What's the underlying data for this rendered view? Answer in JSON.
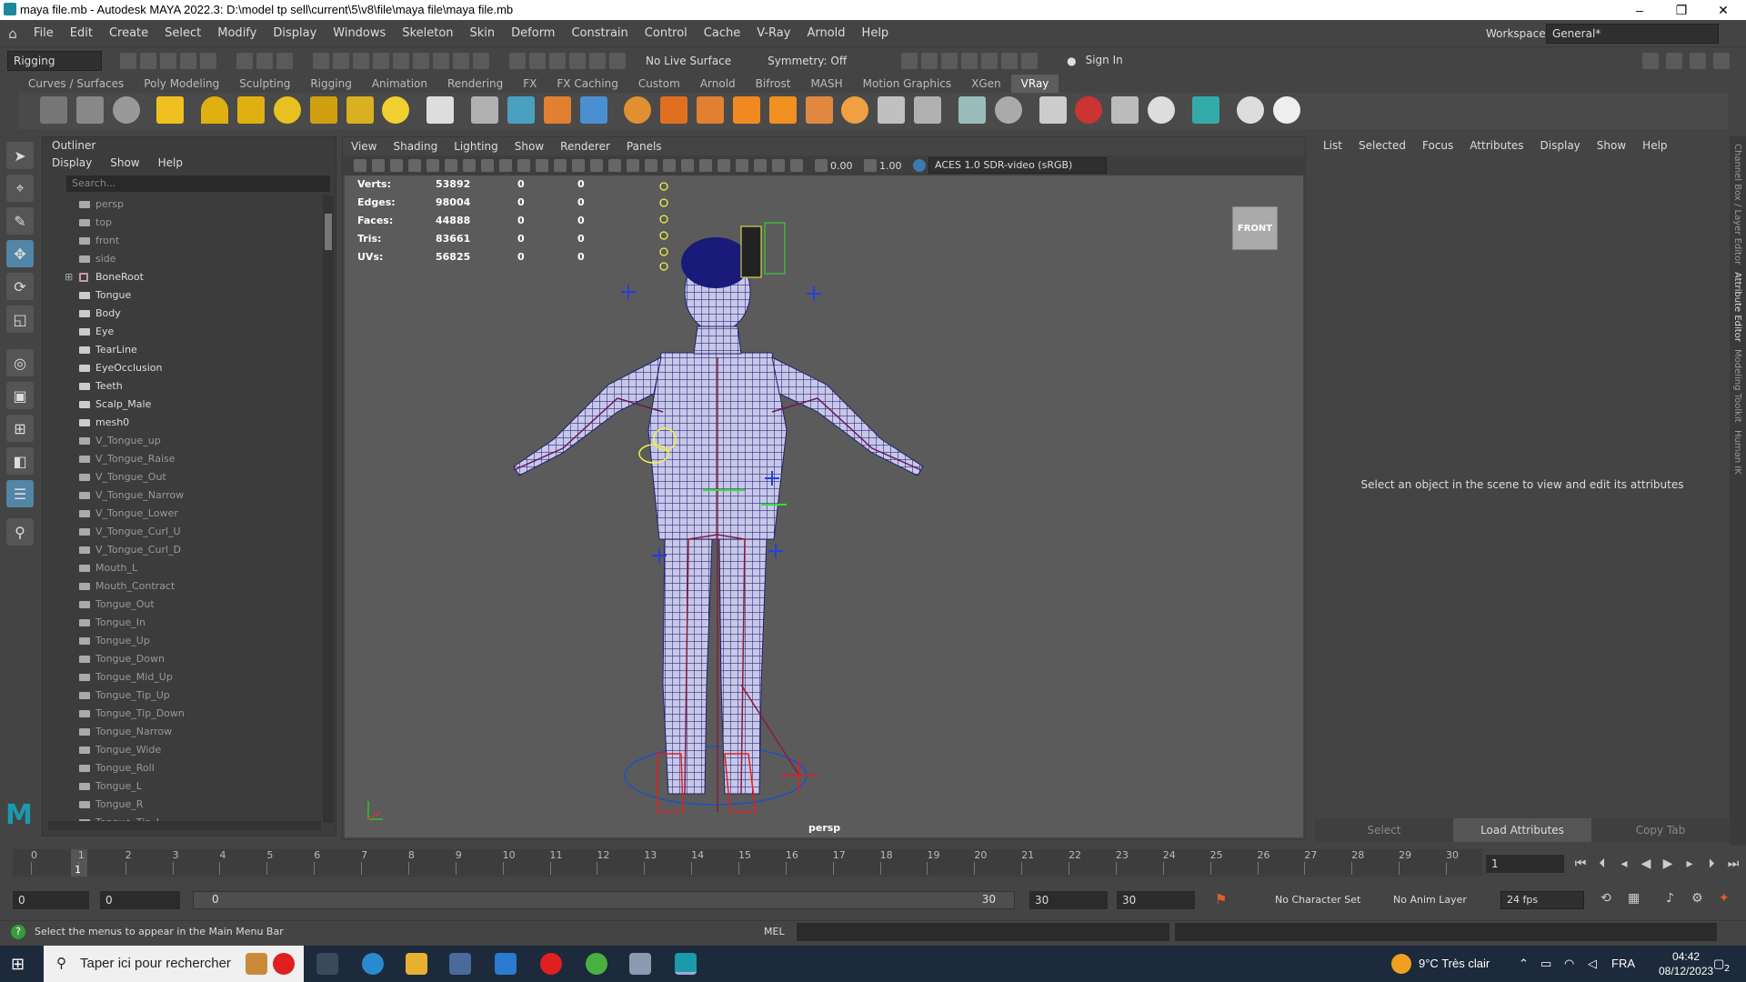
{
  "window": {
    "title": "maya file.mb - Autodesk MAYA 2022.3: D:\\model tp sell\\current\\5\\v8\\file\\maya file\\maya file.mb",
    "minimize": "–",
    "maximize": "❐",
    "close": "✕"
  },
  "menubar": {
    "items": [
      "File",
      "Edit",
      "Create",
      "Select",
      "Modify",
      "Display",
      "Windows",
      "Skeleton",
      "Skin",
      "Deform",
      "Constrain",
      "Control",
      "Cache",
      "V-Ray",
      "Arnold",
      "Help"
    ],
    "workspace_label": "Workspace:",
    "workspace_value": "General*"
  },
  "statusline": {
    "menuset": "Rigging",
    "live_surface": "No Live Surface",
    "symmetry": "Symmetry: Off",
    "sign_in": "Sign In"
  },
  "shelf": {
    "tabs": [
      "Curves / Surfaces",
      "Poly Modeling",
      "Sculpting",
      "Rigging",
      "Animation",
      "Rendering",
      "FX",
      "FX Caching",
      "Custom",
      "Arnold",
      "Bifrost",
      "MASH",
      "Motion Graphics",
      "XGen",
      "VRay"
    ],
    "active_tab": "VRay"
  },
  "outliner": {
    "title": "Outliner",
    "menu": [
      "Display",
      "Show",
      "Help"
    ],
    "search_placeholder": "Search...",
    "items": [
      {
        "label": "persp",
        "kind": "camera",
        "dim": true
      },
      {
        "label": "top",
        "kind": "camera",
        "dim": true
      },
      {
        "label": "front",
        "kind": "camera",
        "dim": true
      },
      {
        "label": "side",
        "kind": "camera",
        "dim": true
      },
      {
        "label": "BoneRoot",
        "kind": "joint",
        "dim": false,
        "expand": "⊞"
      },
      {
        "label": "Tongue",
        "kind": "mesh",
        "dim": false
      },
      {
        "label": "Body",
        "kind": "mesh",
        "dim": false
      },
      {
        "label": "Eye",
        "kind": "mesh",
        "dim": false
      },
      {
        "label": "TearLine",
        "kind": "mesh",
        "dim": false
      },
      {
        "label": "EyeOcclusion",
        "kind": "mesh",
        "dim": false
      },
      {
        "label": "Teeth",
        "kind": "mesh",
        "dim": false
      },
      {
        "label": "Scalp_Male",
        "kind": "mesh",
        "dim": false
      },
      {
        "label": "mesh0",
        "kind": "mesh",
        "dim": false
      },
      {
        "label": "V_Tongue_up",
        "kind": "mesh",
        "dim": true
      },
      {
        "label": "V_Tongue_Raise",
        "kind": "mesh",
        "dim": true
      },
      {
        "label": "V_Tongue_Out",
        "kind": "mesh",
        "dim": true
      },
      {
        "label": "V_Tongue_Narrow",
        "kind": "mesh",
        "dim": true
      },
      {
        "label": "V_Tongue_Lower",
        "kind": "mesh",
        "dim": true
      },
      {
        "label": "V_Tongue_Curl_U",
        "kind": "mesh",
        "dim": true
      },
      {
        "label": "V_Tongue_Curl_D",
        "kind": "mesh",
        "dim": true
      },
      {
        "label": "Mouth_L",
        "kind": "mesh",
        "dim": true
      },
      {
        "label": "Mouth_Contract",
        "kind": "mesh",
        "dim": true
      },
      {
        "label": "Tongue_Out",
        "kind": "mesh",
        "dim": true
      },
      {
        "label": "Tongue_In",
        "kind": "mesh",
        "dim": true
      },
      {
        "label": "Tongue_Up",
        "kind": "mesh",
        "dim": true
      },
      {
        "label": "Tongue_Down",
        "kind": "mesh",
        "dim": true
      },
      {
        "label": "Tongue_Mid_Up",
        "kind": "mesh",
        "dim": true
      },
      {
        "label": "Tongue_Tip_Up",
        "kind": "mesh",
        "dim": true
      },
      {
        "label": "Tongue_Tip_Down",
        "kind": "mesh",
        "dim": true
      },
      {
        "label": "Tongue_Narrow",
        "kind": "mesh",
        "dim": true
      },
      {
        "label": "Tongue_Wide",
        "kind": "mesh",
        "dim": true
      },
      {
        "label": "Tongue_Roll",
        "kind": "mesh",
        "dim": true
      },
      {
        "label": "Tongue_L",
        "kind": "mesh",
        "dim": true
      },
      {
        "label": "Tongue_R",
        "kind": "mesh",
        "dim": true
      },
      {
        "label": "Tongue_Tip_L",
        "kind": "mesh",
        "dim": true
      }
    ]
  },
  "viewport": {
    "menu": [
      "View",
      "Shading",
      "Lighting",
      "Show",
      "Renderer",
      "Panels"
    ],
    "exposure": "0.00",
    "gamma": "1.00",
    "colorspace": "ACES 1.0 SDR-video (sRGB)",
    "hud": [
      {
        "k": "Verts:",
        "v": "53892",
        "a": "0",
        "b": "0"
      },
      {
        "k": "Edges:",
        "v": "98004",
        "a": "0",
        "b": "0"
      },
      {
        "k": "Faces:",
        "v": "44888",
        "a": "0",
        "b": "0"
      },
      {
        "k": "Tris:",
        "v": "83661",
        "a": "0",
        "b": "0"
      },
      {
        "k": "UVs:",
        "v": "56825",
        "a": "0",
        "b": "0"
      }
    ],
    "viewcube": "FRONT",
    "camera": "persp"
  },
  "attribute_editor": {
    "menu": [
      "List",
      "Selected",
      "Focus",
      "Attributes",
      "Display",
      "Show",
      "Help"
    ],
    "message": "Select an object in the scene to view and edit its attributes",
    "buttons": [
      "Select",
      "Load Attributes",
      "Copy Tab"
    ]
  },
  "side_tabs": [
    "Channel Box / Layer Editor",
    "Attribute Editor",
    "Modeling Toolkit",
    "Human IK"
  ],
  "timeline": {
    "ticks": [
      "0",
      "1",
      "2",
      "3",
      "4",
      "5",
      "6",
      "7",
      "8",
      "9",
      "10",
      "11",
      "12",
      "13",
      "14",
      "15",
      "16",
      "17",
      "18",
      "19",
      "20",
      "21",
      "22",
      "23",
      "24",
      "25",
      "26",
      "27",
      "28",
      "29",
      "30"
    ],
    "current": "1",
    "current_frame_field": "1"
  },
  "range": {
    "start": "0",
    "anim_start": "0",
    "slider_left": "0",
    "slider_right": "30",
    "anim_end": "30",
    "end": "30",
    "character_set": "No Character Set",
    "anim_layer": "No Anim Layer",
    "fps": "24 fps"
  },
  "helpline": {
    "text": "Select the menus to appear in the Main Menu Bar",
    "mel": "MEL"
  },
  "taskbar": {
    "search": "Taper ici pour rechercher",
    "weather": "9°C  Très clair",
    "lang": "FRA",
    "time": "04:42",
    "date": "08/12/2023",
    "notif": "2"
  },
  "colors": {
    "accent": "#5285a6",
    "wire": "#2a2a9a",
    "joint": "#d02020",
    "select_yellow": "#f0f050",
    "vray_tab": "#5d5d5d"
  }
}
